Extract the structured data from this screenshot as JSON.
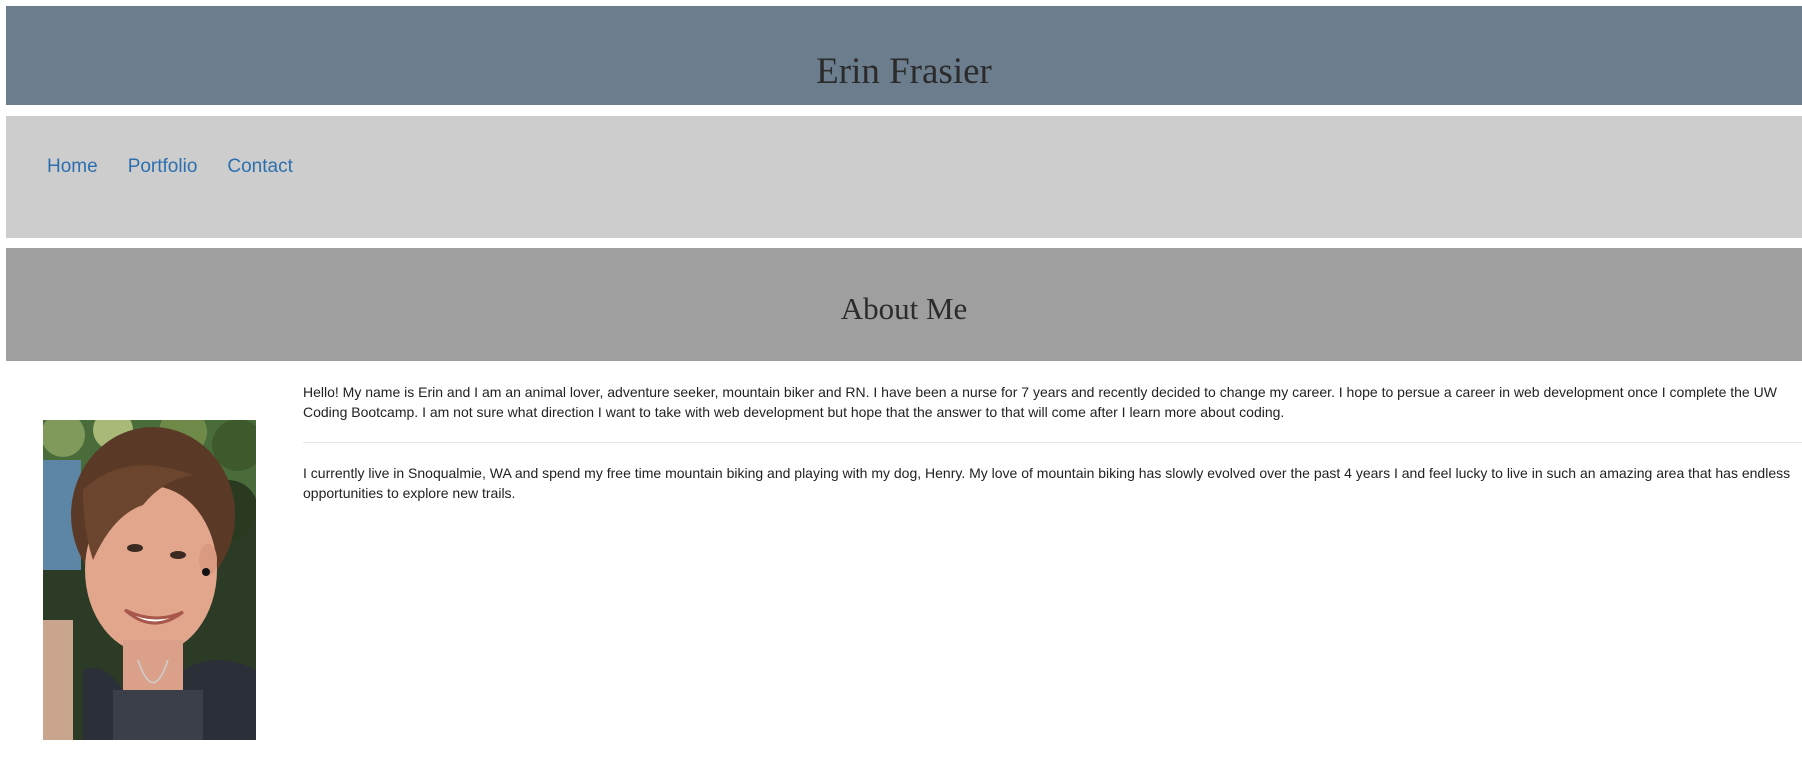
{
  "header": {
    "title": "Erin Frasier"
  },
  "nav": {
    "items": [
      {
        "label": "Home"
      },
      {
        "label": "Portfolio"
      },
      {
        "label": "Contact"
      }
    ]
  },
  "about": {
    "title": "About Me",
    "photo_alt": "Erin Frasier",
    "paragraphs": [
      "Hello! My name is Erin and I am an animal lover, adventure seeker, mountain biker and RN. I have been a nurse for 7 years and recently decided to change my career. I hope to persue a career in web development once I complete the UW Coding Bootcamp. I am not sure what direction I want to take with web development but hope that the answer to that will come after I learn more about coding.",
      "I currently live in Snoqualmie, WA and spend my free time mountain biking and playing with my dog, Henry. My love of mountain biking has slowly evolved over the past 4 years I and feel lucky to live in such an amazing area that has endless opportunities to explore new trails."
    ]
  },
  "colors": {
    "header_bg": "#6c7d8d",
    "nav_bg": "#cdcdcd",
    "about_bg": "#9f9f9f",
    "link": "#2d6fae",
    "text": "#222222"
  }
}
